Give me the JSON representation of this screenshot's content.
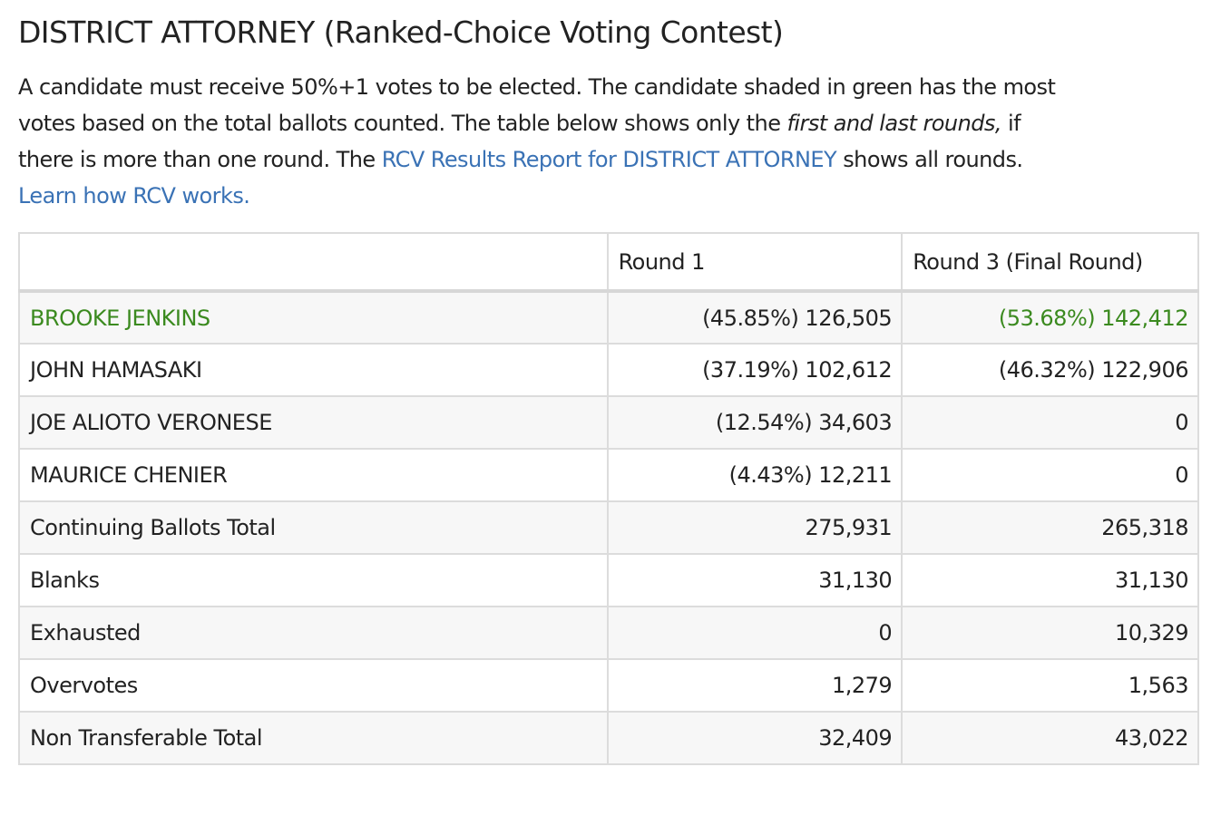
{
  "title": "DISTRICT ATTORNEY (Ranked-Choice Voting Contest)",
  "intro": {
    "line1": "A candidate must receive 50%+1 votes to be elected. The candidate shaded in green has the most",
    "line2_before": "votes based on the total ballots counted. The table below shows only the ",
    "line2_em": "first and last rounds,",
    "line2_after": " if",
    "line3_before": "there is more than one round. The ",
    "line3_link": "RCV Results Report for DISTRICT ATTORNEY",
    "line3_after": " shows all rounds.",
    "learn_link": "Learn how RCV works."
  },
  "colors": {
    "link": "#3a72b5",
    "leader_green": "#3b8a1f",
    "border": "#dcdcdc",
    "stripe": "#f7f7f7"
  },
  "table": {
    "headers": [
      "",
      "Round 1",
      "Round 3 (Final Round)"
    ],
    "rows": [
      {
        "name": "BROOKE JENKINS",
        "round1": "(45.85%) 126,505",
        "final": "(53.68%) 142,412",
        "leader": true
      },
      {
        "name": "JOHN HAMASAKI",
        "round1": "(37.19%) 102,612",
        "final": "(46.32%) 122,906",
        "leader": false
      },
      {
        "name": "JOE ALIOTO VERONESE",
        "round1": "(12.54%) 34,603",
        "final": "0",
        "leader": false
      },
      {
        "name": "MAURICE CHENIER",
        "round1": "(4.43%) 12,211",
        "final": "0",
        "leader": false
      },
      {
        "name": "Continuing Ballots Total",
        "round1": "275,931",
        "final": "265,318",
        "leader": false
      },
      {
        "name": "Blanks",
        "round1": "31,130",
        "final": "31,130",
        "leader": false
      },
      {
        "name": "Exhausted",
        "round1": "0",
        "final": "10,329",
        "leader": false
      },
      {
        "name": "Overvotes",
        "round1": "1,279",
        "final": "1,563",
        "leader": false
      },
      {
        "name": "Non Transferable Total",
        "round1": "32,409",
        "final": "43,022",
        "leader": false
      }
    ]
  }
}
